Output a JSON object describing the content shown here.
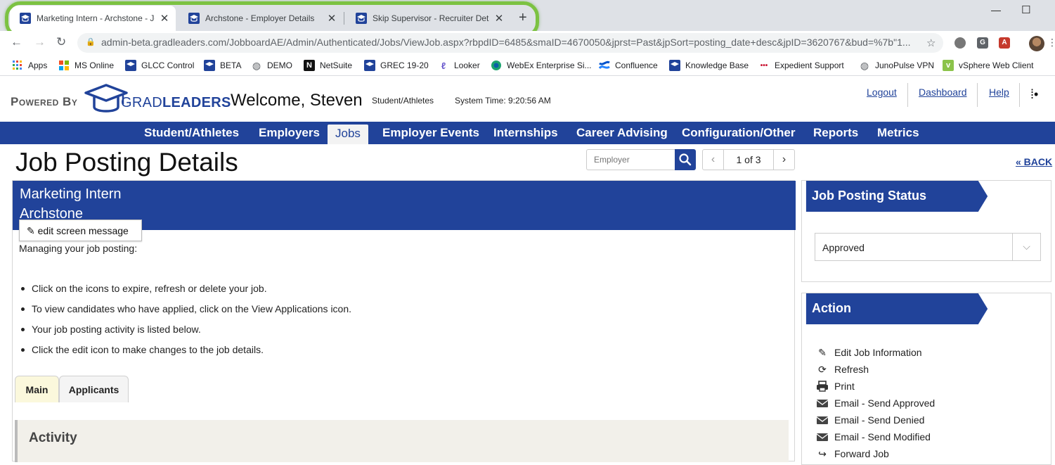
{
  "browser": {
    "tabs": [
      {
        "title": "Marketing Intern - Archstone - Jo",
        "active": true
      },
      {
        "title": "Archstone - Employer Details",
        "active": false
      },
      {
        "title": "Skip Supervisor - Recruiter Detail",
        "active": false
      }
    ],
    "url": "admin-beta.gradleaders.com/JobboardAE/Admin/Authenticated/Jobs/ViewJob.aspx?rbpdID=6485&smaID=4670050&jprst=Past&jpSort=posting_date+desc&jpID=3620767&bud=%7b\"1...",
    "highlight_color": "#7cc242",
    "bookmarks": [
      {
        "label": "Apps",
        "icon": "apps-grid-icon"
      },
      {
        "label": "MS Online",
        "icon": "microsoft-icon"
      },
      {
        "label": "GLCC Control",
        "icon": "gradleaders-icon"
      },
      {
        "label": "BETA",
        "icon": "gradleaders-icon"
      },
      {
        "label": "DEMO",
        "icon": "globe-icon"
      },
      {
        "label": "NetSuite",
        "icon": "netsuite-icon"
      },
      {
        "label": "GREC 19-20",
        "icon": "gradleaders-icon"
      },
      {
        "label": "Looker",
        "icon": "looker-icon"
      },
      {
        "label": "WebEx Enterprise Si...",
        "icon": "webex-icon"
      },
      {
        "label": "Confluence",
        "icon": "confluence-icon"
      },
      {
        "label": "Knowledge Base",
        "icon": "gradleaders-icon"
      },
      {
        "label": "Expedient Support",
        "icon": "expedient-icon"
      },
      {
        "label": "JunoPulse VPN",
        "icon": "globe-icon"
      },
      {
        "label": "vSphere Web Client",
        "icon": "vsphere-icon"
      }
    ]
  },
  "header": {
    "powered_by": "Powered By",
    "logo_grad": "GRAD",
    "logo_leaders": "LEADERS",
    "welcome": "Welcome, Steven",
    "role": "Student/Athletes",
    "system_time": "System Time: 9:20:56 AM",
    "links": [
      "Logout",
      "Dashboard",
      "Help"
    ]
  },
  "nav": {
    "items": [
      "Student/Athletes",
      "Employers",
      "Jobs",
      "Employer Events",
      "Internships",
      "Career Advising",
      "Configuration/Other",
      "Reports",
      "Metrics"
    ],
    "active": "Jobs"
  },
  "page": {
    "title": "Job Posting Details",
    "employer_placeholder": "Employer",
    "pager_label": "1 of 3",
    "back_label": "« BACK"
  },
  "job": {
    "title": "Marketing Intern",
    "employer": "Archstone",
    "edit_message_label": "edit screen message",
    "message_intro": "Managing your job posting:",
    "message_bullets": [
      "Click on the icons to expire, refresh or delete your job.",
      "To view candidates who have applied, click on the View Applications icon.",
      "Your job posting activity is listed below.",
      "Click the edit icon to make changes to the job details."
    ],
    "tabs": [
      "Main",
      "Applicants"
    ],
    "active_tab": "Main",
    "activity_title": "Activity"
  },
  "status_card": {
    "title": "Job Posting Status",
    "selected": "Approved"
  },
  "action_card": {
    "title": "Action",
    "items": [
      {
        "label": "Edit Job Information",
        "icon": "pencil-icon"
      },
      {
        "label": "Refresh",
        "icon": "refresh-icon"
      },
      {
        "label": "Print",
        "icon": "printer-icon"
      },
      {
        "label": "Email - Send Approved",
        "icon": "envelope-icon"
      },
      {
        "label": "Email - Send Denied",
        "icon": "envelope-icon"
      },
      {
        "label": "Email - Send Modified",
        "icon": "envelope-icon"
      },
      {
        "label": "Forward Job",
        "icon": "forward-icon"
      }
    ]
  },
  "colors": {
    "brand_blue": "#21439a",
    "main_tab_bg": "#fbf8dc"
  }
}
